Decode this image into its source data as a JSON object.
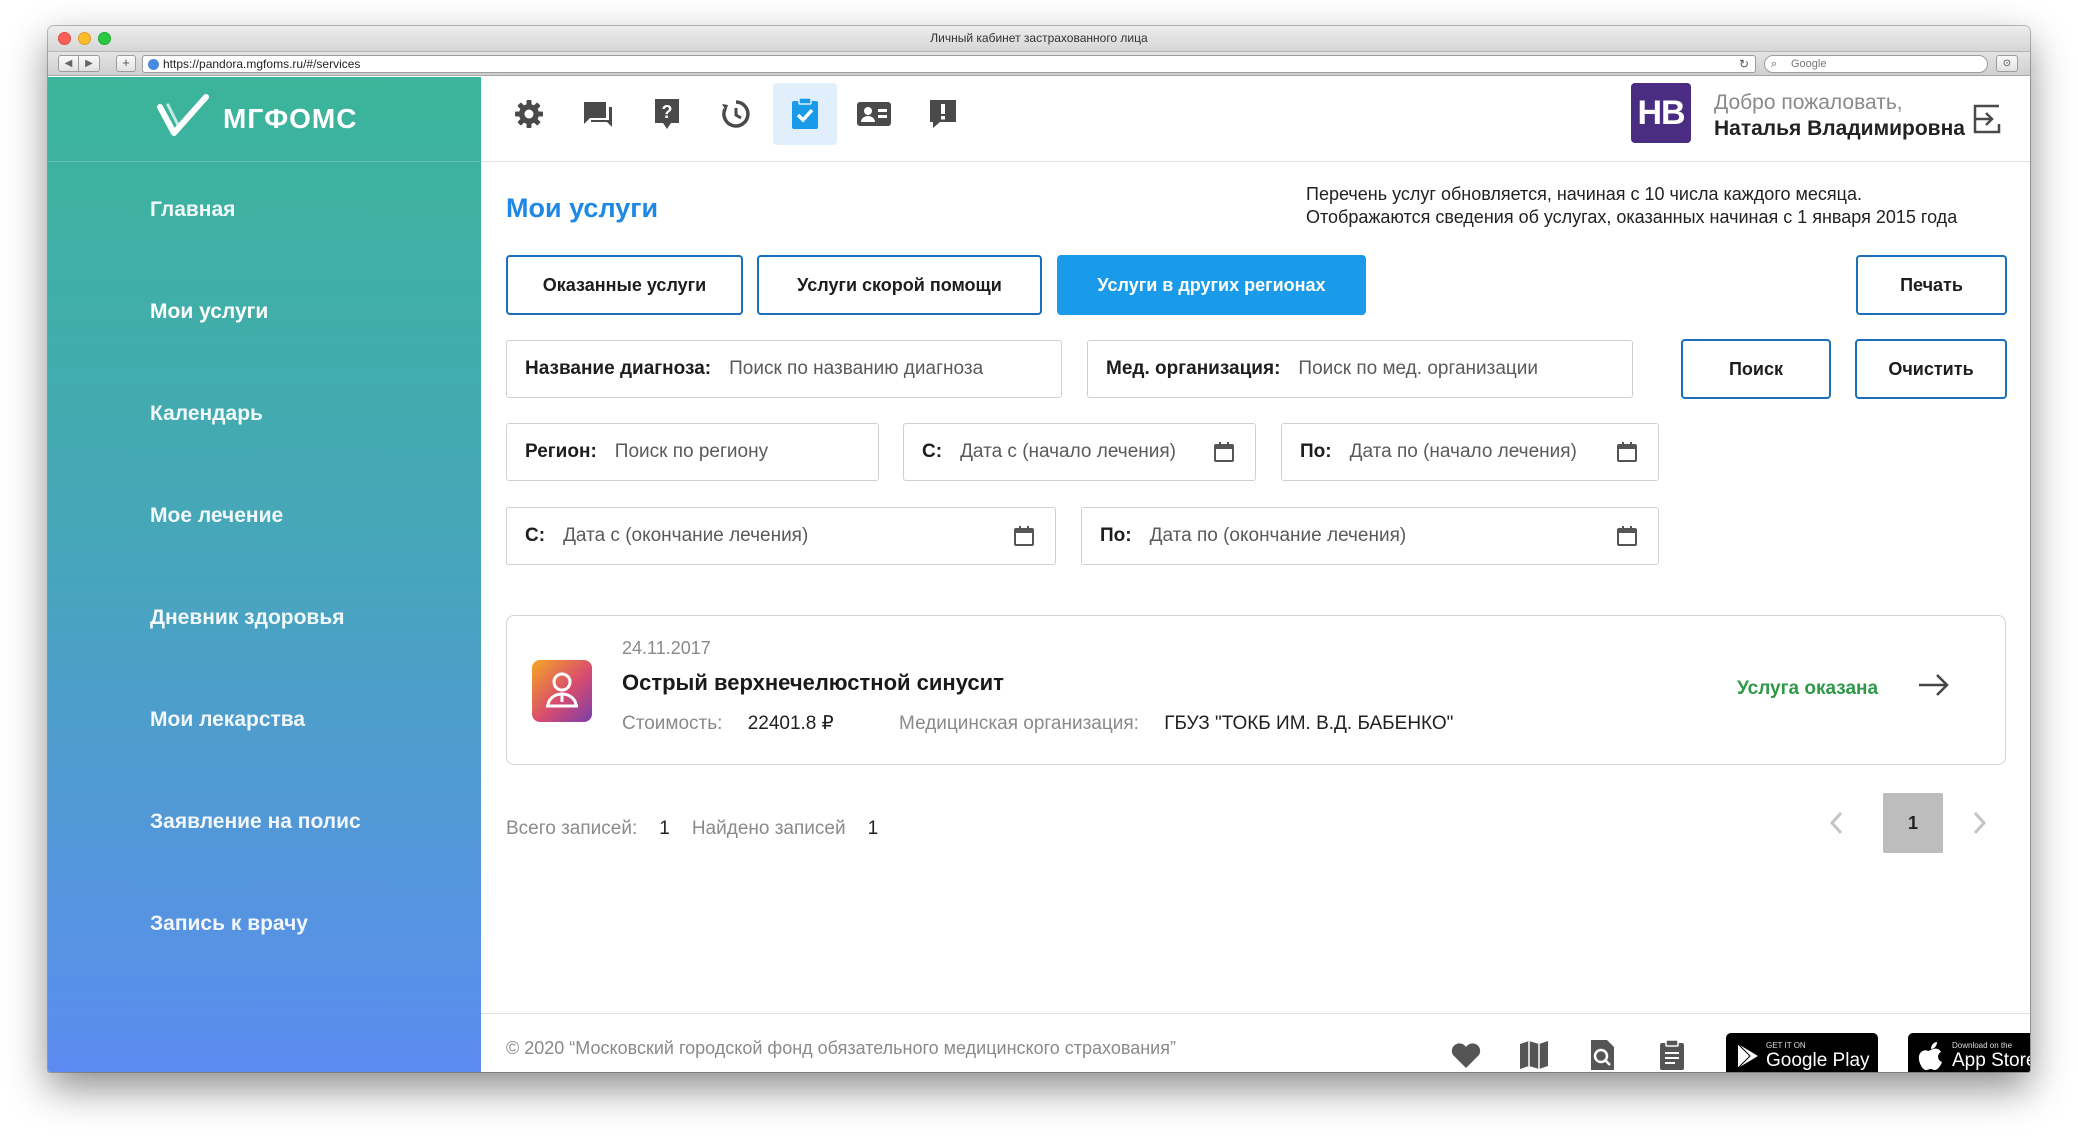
{
  "browser": {
    "title": "Личный кабинет застрахованного лица",
    "url": "https://pandora.mgfoms.ru/#/services",
    "search_placeholder": "Google"
  },
  "brand": {
    "name": "МГФОМС"
  },
  "sidebar": {
    "items": [
      {
        "label": "Главная"
      },
      {
        "label": "Мои услуги"
      },
      {
        "label": "Календарь"
      },
      {
        "label": "Мое лечение"
      },
      {
        "label": "Дневник здоровья"
      },
      {
        "label": "Мои лекарства"
      },
      {
        "label": "Заявление на полис"
      },
      {
        "label": "Запись к врачу"
      }
    ]
  },
  "topbar": {
    "icons": [
      "gear-icon",
      "chat-icon",
      "help-icon",
      "history-icon",
      "services-icon",
      "contacts-icon",
      "alert-icon"
    ],
    "active_icon": "services-icon",
    "avatar_initials": "НВ",
    "welcome": "Добро пожаловать,",
    "user_name": "Наталья Владимировна"
  },
  "page": {
    "title": "Мои услуги",
    "notice_line1": "Перечень услуг обновляется, начиная с 10 числа каждого месяца.",
    "notice_line2": "Отображаются сведения об услугах, оказанных начиная с 1 января 2015 года"
  },
  "tabs": [
    {
      "label": "Оказанные услуги",
      "active": false
    },
    {
      "label": "Услуги скорой помощи",
      "active": false
    },
    {
      "label": "Услуги в других регионах",
      "active": true
    }
  ],
  "actions": {
    "print": "Печать",
    "search": "Поиск",
    "clear": "Очистить"
  },
  "filters": {
    "diagnosis": {
      "label": "Название диагноза:",
      "placeholder": "Поиск по названию диагноза"
    },
    "organization": {
      "label": "Мед. организация:",
      "placeholder": "Поиск по мед. организации"
    },
    "region": {
      "label": "Регион:",
      "placeholder": "Поиск по региону"
    },
    "start_from": {
      "label": "С:",
      "placeholder": "Дата с (начало лечения)"
    },
    "start_to": {
      "label": "По:",
      "placeholder": "Дата по (начало лечения)"
    },
    "end_from": {
      "label": "С:",
      "placeholder": "Дата с (окончание лечения)"
    },
    "end_to": {
      "label": "По:",
      "placeholder": "Дата по (окончание лечения)"
    }
  },
  "records": [
    {
      "date": "24.11.2017",
      "title": "Острый верхнечелюстной синусит",
      "cost_label": "Стоимость:",
      "cost": "22401.8 ₽",
      "org_label": "Медицинская организация:",
      "org": "ГБУЗ \"ТОКБ ИМ. В.Д. БАБЕНКО\"",
      "status": "Услуга оказана"
    }
  ],
  "summary": {
    "total_label": "Всего записей:",
    "total": "1",
    "found_label": "Найдено записей",
    "found": "1"
  },
  "pagination": {
    "current": "1"
  },
  "footer": {
    "copyright": "© 2020 “Московский городской фонд обязательного медицинского страхования”",
    "google_play_small": "GET IT ON",
    "google_play": "Google Play",
    "app_store_small": "Download on the",
    "app_store": "App Store"
  },
  "colors": {
    "accent": "#1a9bea",
    "title": "#1e88e5",
    "status_ok": "#2e9a48",
    "avatar": "#4a2d83"
  }
}
